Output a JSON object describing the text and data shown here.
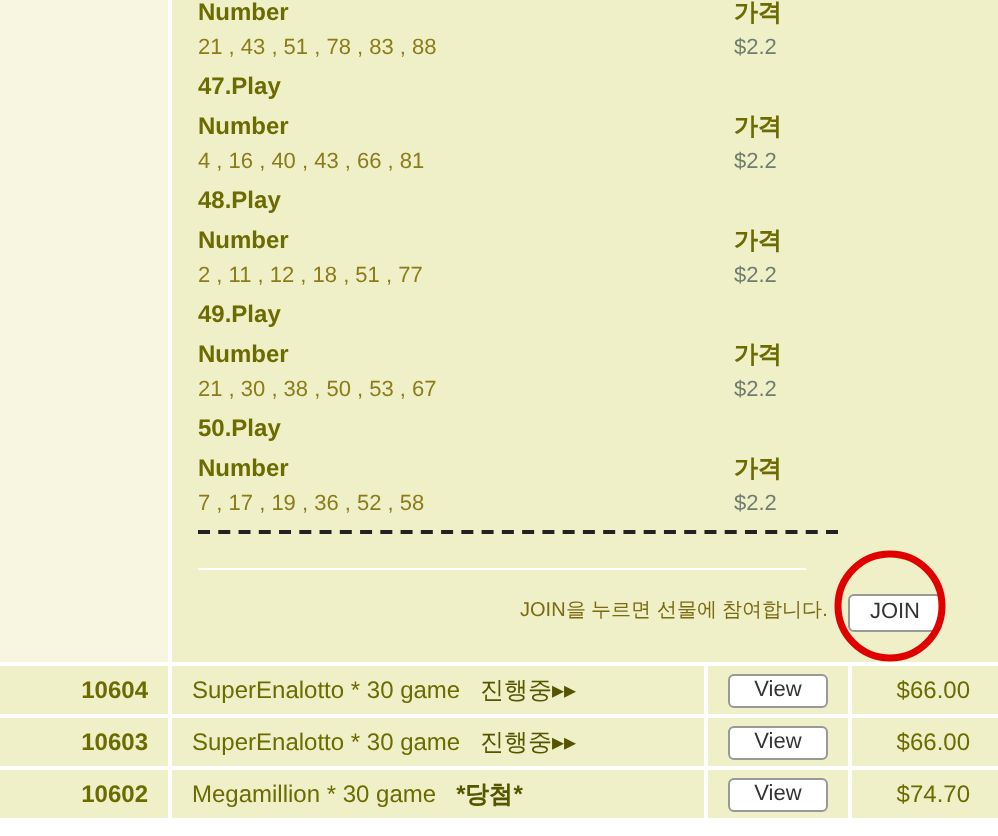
{
  "plays": [
    {
      "number_label": "Number",
      "price_label": "가격",
      "numbers": "21 , 43 , 51 , 78 , 83 , 88",
      "price": "$2.2"
    },
    {
      "title": "47.Play",
      "number_label": "Number",
      "price_label": "가격",
      "numbers": "4 , 16 , 40 , 43 , 66 , 81",
      "price": "$2.2"
    },
    {
      "title": "48.Play",
      "number_label": "Number",
      "price_label": "가격",
      "numbers": "2 , 11 , 12 , 18 , 51 , 77",
      "price": "$2.2"
    },
    {
      "title": "49.Play",
      "number_label": "Number",
      "price_label": "가격",
      "numbers": "21 , 30 , 38 , 50 , 53 , 67",
      "price": "$2.2"
    },
    {
      "title": "50.Play",
      "number_label": "Number",
      "price_label": "가격",
      "numbers": "7 , 17 , 19 , 36 , 52 , 58",
      "price": "$2.2"
    }
  ],
  "join": {
    "note": "JOIN을 누르면 선물에 참여합니다.",
    "button": "JOIN"
  },
  "rows": [
    {
      "id": "10604",
      "name": "SuperEnalotto * 30 game",
      "status": "진행중▸▸",
      "kind": "ongoing",
      "action": "View",
      "amount": "$66.00"
    },
    {
      "id": "10603",
      "name": "SuperEnalotto * 30 game",
      "status": "진행중▸▸",
      "kind": "ongoing",
      "action": "View",
      "amount": "$66.00"
    },
    {
      "id": "10602",
      "name": "Megamillion * 30 game",
      "status": "*당첨*",
      "kind": "won",
      "action": "View",
      "amount": "$74.70"
    }
  ]
}
